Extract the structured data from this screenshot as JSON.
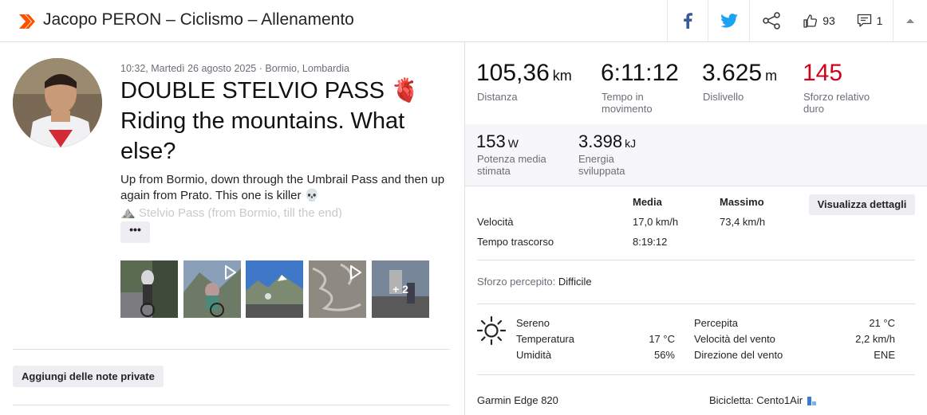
{
  "header": {
    "title": "Jacopo PERON – Ciclismo – Allenamento",
    "likes": "93",
    "comments": "1",
    "brand_color": "#fc5200"
  },
  "activity": {
    "meta": "10:32, Martedì 26 agosto 2025 · Bormio, Lombardia",
    "title": "DOUBLE STELVIO PASS 🫀 Riding the mountains. What else?",
    "description": "Up from Bormio, down through the Umbrail Pass and then up again from Prato. This one is killer 💀",
    "description_fade": "⛰️ Stelvio Pass (from Bormio, till the end)",
    "more_label": "•••",
    "photos_more": "+ 2",
    "notes_label": "Aggiungi delle note private"
  },
  "stats": {
    "distance_value": "105,36",
    "distance_unit": "km",
    "distance_label": "Distanza",
    "moving_value": "6:11:12",
    "moving_label": "Tempo in movimento",
    "elev_value": "3.625",
    "elev_unit": "m",
    "elev_label": "Dislivello",
    "effort_value": "145",
    "effort_label": "Sforzo relativo duro",
    "effort_color": "#d0021b",
    "power_value": "153",
    "power_unit": "W",
    "power_label": "Potenza media stimata",
    "energy_value": "3.398",
    "energy_unit": "kJ",
    "energy_label": "Energia sviluppata"
  },
  "table": {
    "col_media": "Media",
    "col_massimo": "Massimo",
    "details_button": "Visualizza dettagli",
    "speed_label": "Velocità",
    "speed_avg": "17,0 km/h",
    "speed_max": "73,4 km/h",
    "elapsed_label": "Tempo trascorso",
    "elapsed_avg": "8:19:12"
  },
  "perceived": {
    "label": "Sforzo percepito:",
    "value": "Difficile"
  },
  "weather": {
    "condition": "Sereno",
    "temp_label": "Temperatura",
    "temp_value": "17 °C",
    "humidity_label": "Umidità",
    "humidity_value": "56%",
    "feels_label": "Percepita",
    "feels_value": "21 °C",
    "wind_speed_label": "Velocità del vento",
    "wind_speed_value": "2,2 km/h",
    "wind_dir_label": "Direzione del vento",
    "wind_dir_value": "ENE"
  },
  "footer": {
    "device": "Garmin Edge 820",
    "bike": "Bicicletta: Cento1Air"
  }
}
